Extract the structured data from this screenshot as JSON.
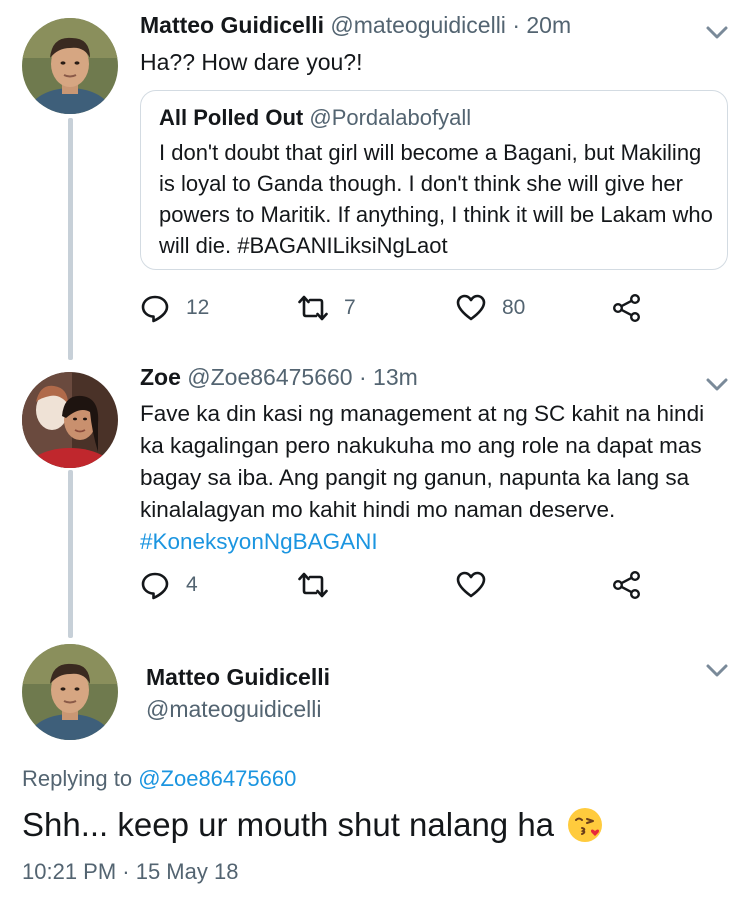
{
  "tweet1": {
    "name": "Matteo Guidicelli",
    "handle": "@mateoguidicelli",
    "separator": "·",
    "time": "20m",
    "text": "Ha?? How dare you?!",
    "quote": {
      "name": "All Polled Out",
      "handle": "@Pordalabofyall",
      "text": "I don't doubt that girl will become a Bagani, but Makiling is loyal to Ganda though.  I don't think she will give her powers to Maritik.  If anything, I think it will be Lakam who will die. #BAGANILiksiNgLaot"
    },
    "actions": {
      "reply_count": "12",
      "retweet_count": "7",
      "like_count": "80"
    }
  },
  "tweet2": {
    "name": "Zoe",
    "handle": "@Zoe86475660",
    "separator": "·",
    "time": "13m",
    "text": "Fave ka din kasi ng management at ng SC kahit na hindi ka kagalingan pero nakukuha mo ang role na dapat mas bagay sa iba. Ang pangit ng ganun, napunta ka lang sa kinalalagyan mo kahit hindi mo naman deserve.",
    "hashtag": "#KoneksyonNgBAGANI",
    "actions": {
      "reply_count": "4"
    }
  },
  "main_tweet": {
    "name": "Matteo Guidicelli",
    "handle": "@mateoguidicelli",
    "replying_prefix": "Replying to",
    "replying_to": "@Zoe86475660",
    "text": "Shh... keep ur mouth shut nalang ha",
    "emoji": "face-blowing-kiss-emoji",
    "timestamp": "10:21 PM · 15 May 18"
  },
  "colors": {
    "link": "#1b95e0",
    "secondary_text": "#536471",
    "thread_line": "#c7d0d8"
  }
}
